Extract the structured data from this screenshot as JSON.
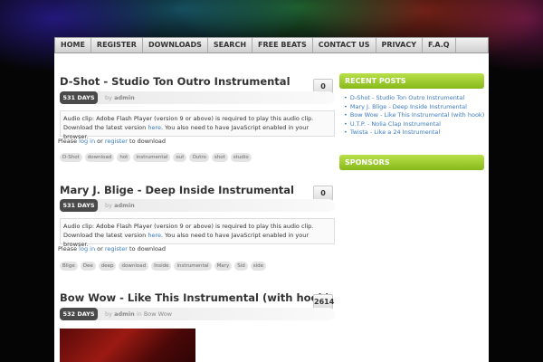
{
  "nav": {
    "items": [
      "HOME",
      "REGISTER",
      "DOWNLOADS",
      "SEARCH",
      "FREE BEATS",
      "CONTACT US",
      "PRIVACY",
      "F.A.Q"
    ]
  },
  "audio_notice": {
    "line1": "Audio clip: Adobe Flash Player (version 9 or above) is required to play this audio clip.",
    "line2_prefix": "Download the latest version ",
    "line2_link": "here",
    "line2_suffix": ". You also need to have JavaScript enabled in your browser."
  },
  "login": {
    "prefix": "Please ",
    "login_link": "log in",
    "middle": " or ",
    "register_link": "register",
    "suffix": " to download"
  },
  "posts": [
    {
      "title": "D-Shot - Studio Ton Outro Instrumental",
      "comments": "0",
      "days": "531 DAYS",
      "by": "by",
      "author": "admin",
      "tags": [
        "D-Shot",
        "download",
        "hot",
        "instrumental",
        "out",
        "Outro",
        "shot",
        "studio"
      ]
    },
    {
      "title": "Mary J. Blige - Deep Inside Instrumental",
      "comments": "0",
      "days": "531 DAYS",
      "by": "by",
      "author": "admin",
      "tags": [
        "Blige",
        "Dee",
        "deep",
        "download",
        "Inside",
        "instrumental",
        "Mary",
        "Sid",
        "side"
      ]
    },
    {
      "title": "Bow Wow - Like This Instrumental (with hook)",
      "comments": "2614",
      "days": "532 DAYS",
      "by": "by",
      "author": "admin",
      "in": "in",
      "category": "Bow Wow"
    }
  ],
  "sidebar": {
    "recent_title": "RECENT POSTS",
    "recent_posts": [
      "D-Shot - Studio Ton Outro Instrumental",
      "Mary J. Blige - Deep Inside Instrumental",
      "Bow Wow - Like This Instrumental (with hook)",
      "U.T.P. - Nolia Clap Instrumental",
      "Twista - Like a 24 Instrumental"
    ],
    "sponsors_title": "SPONSORS"
  },
  "colors": {
    "accent_green": "#86b91a",
    "link_blue": "#3a7ac0",
    "badge_dark": "#4a4a4a"
  }
}
